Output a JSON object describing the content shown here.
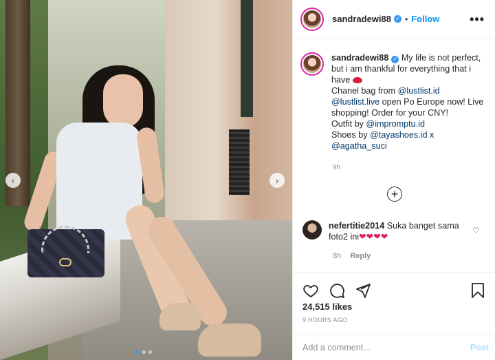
{
  "post": {
    "author": "sandradewi88",
    "header_sep": "•",
    "follow_label": "Follow",
    "more_label": "•••",
    "caption": {
      "username": "sandradewi88",
      "line1": "My life is not perfect, but i am thankful for everything that i have",
      "line2_prefix": "Chanel bag from ",
      "mention_lustlist": "@lustlist.id",
      "mention_lustlist_live": "@lustlist.live",
      "line3_suffix": " open Po Europe now! Live shopping! Order for your CNY!",
      "outfit_prefix": "Outfit by ",
      "mention_impromptu": "@impromptu.id",
      "shoes_prefix": "Shoes by ",
      "mention_tayashoes": "@tayashoes.id",
      "shoes_suffix": " x",
      "mention_agatha": "@agatha_suci",
      "time": "9h"
    },
    "load_more_label": "+",
    "comment": {
      "username": "nefertitie2014",
      "text": "Suka banget sama foto2 ini",
      "hearts": "❤❤❤❤",
      "time": "8h",
      "reply_label": "Reply"
    },
    "likes": "24,515 likes",
    "time_ago": "9 HOURS AGO",
    "add_comment_placeholder": "Add a comment...",
    "post_label": "Post",
    "carousel": {
      "slides": 3,
      "active": 1
    },
    "colors": {
      "follow": "#0095f6",
      "mention": "#00376b",
      "post_disabled": "#b2dffc",
      "verified": "#3897f0"
    }
  }
}
